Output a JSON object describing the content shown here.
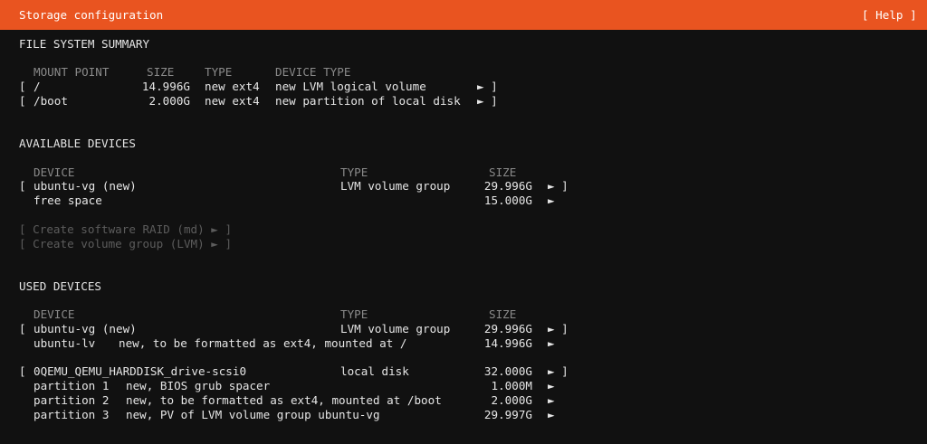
{
  "header": {
    "title": "Storage configuration",
    "help": "[ Help ]"
  },
  "fs_summary": {
    "section_title": "FILE SYSTEM SUMMARY",
    "col_mount": "MOUNT POINT",
    "col_size": "SIZE",
    "col_type": "TYPE",
    "col_device_type": "DEVICE TYPE",
    "rows": [
      {
        "open": "[",
        "mount": "/",
        "size": "14.996G",
        "type": "new ext4",
        "device_type": "new LVM logical volume",
        "arrow": "► ]"
      },
      {
        "open": "[",
        "mount": "/boot",
        "size": "2.000G",
        "type": "new ext4",
        "device_type": "new partition of local disk",
        "arrow": "► ]"
      }
    ]
  },
  "available": {
    "section_title": "AVAILABLE DEVICES",
    "col_device": "DEVICE",
    "col_type": "TYPE",
    "col_size": "SIZE",
    "vg": {
      "open": "[",
      "name": "ubuntu-vg (new)",
      "type": "LVM volume group",
      "size": "29.996G",
      "arrow": "► ]"
    },
    "free": {
      "name": "free space",
      "size": "15.000G",
      "arrow": "►"
    },
    "create_raid": "[ Create software RAID (md) ► ]",
    "create_vg": "[ Create volume group (LVM) ► ]"
  },
  "used": {
    "section_title": "USED DEVICES",
    "col_device": "DEVICE",
    "col_type": "TYPE",
    "col_size": "SIZE",
    "vg": {
      "open": "[",
      "name": "ubuntu-vg (new)",
      "type": "LVM volume group",
      "size": "29.996G",
      "arrow": "► ]"
    },
    "lv": {
      "name": "ubuntu-lv",
      "desc": "new, to be formatted as ext4, mounted at /",
      "size": "14.996G",
      "arrow": "►"
    },
    "disk": {
      "open": "[",
      "name": "0QEMU_QEMU_HARDDISK_drive-scsi0",
      "type": "local disk",
      "size": "32.000G",
      "arrow": "► ]"
    },
    "partitions": [
      {
        "name": "partition 1",
        "desc": "new, BIOS grub spacer",
        "size": "1.000M",
        "arrow": "►"
      },
      {
        "name": "partition 2",
        "desc": "new, to be formatted as ext4, mounted at /boot",
        "size": "2.000G",
        "arrow": "►"
      },
      {
        "name": "partition 3",
        "desc": "new, PV of LVM volume group ubuntu-vg",
        "size": "29.997G",
        "arrow": "►"
      }
    ]
  }
}
